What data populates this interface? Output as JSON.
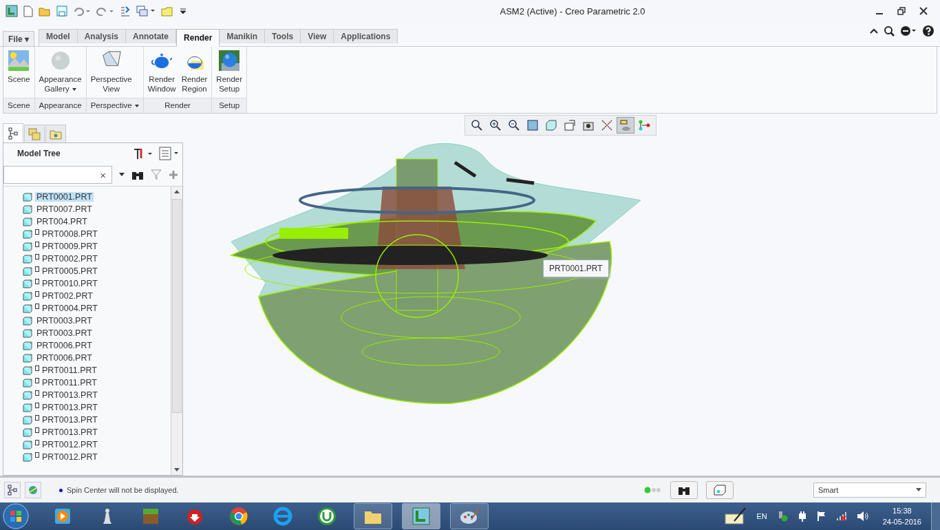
{
  "window": {
    "title": "ASM2 (Active) - Creo Parametric 2.0"
  },
  "file_menu": {
    "label": "File ▾"
  },
  "tabs": [
    {
      "label": "Model",
      "selected": false
    },
    {
      "label": "Analysis",
      "selected": false
    },
    {
      "label": "Annotate",
      "selected": false
    },
    {
      "label": "Render",
      "selected": true
    },
    {
      "label": "Manikin",
      "selected": false
    },
    {
      "label": "Tools",
      "selected": false
    },
    {
      "label": "View",
      "selected": false
    },
    {
      "label": "Applications",
      "selected": false
    }
  ],
  "ribbon_groups": [
    {
      "label": "Scene",
      "has_menu": false,
      "buttons": [
        {
          "label": "Scene",
          "has_menu": false
        }
      ]
    },
    {
      "label": "Appearance",
      "has_menu": false,
      "buttons": [
        {
          "label": "Appearance Gallery",
          "has_menu": true
        }
      ]
    },
    {
      "label": "Perspective",
      "has_menu": true,
      "buttons": [
        {
          "label": "Perspective View",
          "has_menu": false
        }
      ]
    },
    {
      "label": "Render",
      "has_menu": false,
      "buttons": [
        {
          "label": "Render Window",
          "has_menu": false
        },
        {
          "label": "Render Region",
          "has_menu": false
        }
      ]
    },
    {
      "label": "Setup",
      "has_menu": false,
      "buttons": [
        {
          "label": "Render Setup",
          "has_menu": false
        }
      ]
    }
  ],
  "panel_tabs": [
    {
      "selected": true
    },
    {
      "selected": false
    },
    {
      "selected": false
    }
  ],
  "model_tree": {
    "title": "Model Tree",
    "search_clear": "×",
    "items": [
      {
        "label": "PRT0001.PRT",
        "kind": "plain",
        "selected": true
      },
      {
        "label": "PRT0007.PRT",
        "kind": "plain",
        "selected": false
      },
      {
        "label": "PRT004.PRT",
        "kind": "plain",
        "selected": false
      },
      {
        "label": "PRT0008.PRT",
        "kind": "flagged",
        "selected": false
      },
      {
        "label": "PRT0009.PRT",
        "kind": "flagged",
        "selected": false
      },
      {
        "label": "PRT0002.PRT",
        "kind": "flagged",
        "selected": false
      },
      {
        "label": "PRT0005.PRT",
        "kind": "flagged",
        "selected": false
      },
      {
        "label": "PRT0010.PRT",
        "kind": "flagged",
        "selected": false
      },
      {
        "label": "PRT002.PRT",
        "kind": "flagged",
        "selected": false
      },
      {
        "label": "PRT0004.PRT",
        "kind": "flagged",
        "selected": false
      },
      {
        "label": "PRT0003.PRT",
        "kind": "plain",
        "selected": false
      },
      {
        "label": "PRT0003.PRT",
        "kind": "plain",
        "selected": false
      },
      {
        "label": "PRT0006.PRT",
        "kind": "plain",
        "selected": false
      },
      {
        "label": "PRT0006.PRT",
        "kind": "plain",
        "selected": false
      },
      {
        "label": "PRT0011.PRT",
        "kind": "flagged",
        "selected": false
      },
      {
        "label": "PRT0011.PRT",
        "kind": "flagged",
        "selected": false
      },
      {
        "label": "PRT0013.PRT",
        "kind": "flagged",
        "selected": false
      },
      {
        "label": "PRT0013.PRT",
        "kind": "flagged",
        "selected": false
      },
      {
        "label": "PRT0013.PRT",
        "kind": "flagged",
        "selected": false
      },
      {
        "label": "PRT0013.PRT",
        "kind": "flagged",
        "selected": false
      },
      {
        "label": "PRT0012.PRT",
        "kind": "flagged",
        "selected": false
      },
      {
        "label": "PRT0012.PRT",
        "kind": "flagged",
        "selected": false
      }
    ]
  },
  "view_toolbar": [
    {
      "selected": false
    },
    {
      "selected": false
    },
    {
      "selected": false
    },
    {
      "selected": false
    },
    {
      "selected": false
    },
    {
      "selected": false
    },
    {
      "selected": false
    },
    {
      "selected": false
    },
    {
      "selected": true
    },
    {
      "selected": false
    }
  ],
  "tooltip": "PRT0001.PRT",
  "status_bar": {
    "message": "Spin Center will not be displayed.",
    "filter": "Smart"
  },
  "taskbar": {
    "apps": [
      {
        "selected": false
      },
      {
        "selected": false
      },
      {
        "selected": false
      },
      {
        "selected": false
      },
      {
        "selected": false
      },
      {
        "selected": false
      },
      {
        "selected": false
      },
      {
        "selected": false
      },
      {
        "selected": true
      },
      {
        "selected": false
      }
    ],
    "language": "EN",
    "time": "15:38",
    "date": "24-05-2016"
  }
}
